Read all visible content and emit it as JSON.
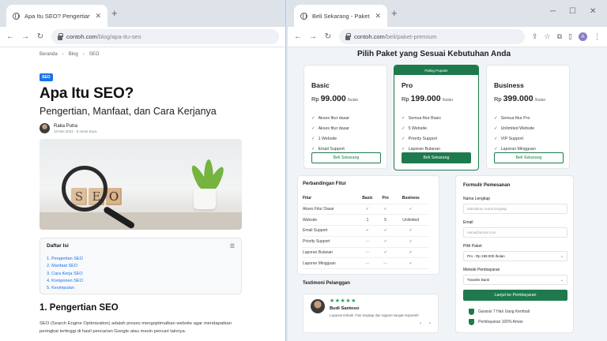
{
  "left_window": {
    "tab_title": "Apa Itu SEO? Pengertian, Manfaat, dan C",
    "url_host": "contoh.com",
    "url_path": "/blog/apa-itu-seo",
    "breadcrumb": [
      "Beranda",
      "Blog",
      "SEO"
    ],
    "badge": "SEO",
    "title": "Apa Itu SEO?",
    "subtitle": "Pengertian, Manfaat, dan Cara Kerjanya",
    "author_name": "Raka Putra",
    "author_meta": "10 Mei 2024  ·  8 menit baca",
    "hero_letters": [
      "S",
      "E",
      "O"
    ],
    "toc_title": "Daftar Isi",
    "toc_items": [
      "1. Pengertian SEO",
      "2. Manfaat SEO",
      "3. Cara Kerja SEO",
      "4. Komponen SEO",
      "5. Kesimpulan"
    ],
    "section_heading": "1. Pengertian SEO",
    "paragraph": "SEO (Search Engine Optimization) adalah proses mengoptimalkan website agar mendapatkan peringkat tertinggi di hasil pencarian Google atau mesin pencari lainnya."
  },
  "right_window": {
    "tab_title": "Beli Sekarang - Paket Premium",
    "url_host": "contoh.com",
    "url_path": "/beli/paket-premium",
    "page_title": "Pilih Paket yang Sesuai Kebutuhan Anda",
    "popular_label": "Paling Populer",
    "plans": [
      {
        "name": "Basic",
        "currency": "Rp",
        "price": "99.000",
        "period": "/bulan",
        "features": [
          "Akses fitur dasar",
          "Akses fitur dasar",
          "1 Website",
          "Email Support"
        ],
        "button": "Beli Sekarang"
      },
      {
        "name": "Pro",
        "currency": "Rp",
        "price": "199.000",
        "period": "/bulan",
        "features": [
          "Semua fitur Basic",
          "5 Website",
          "Priority Support",
          "Laporan Bulanan"
        ],
        "button": "Beli Sekarang"
      },
      {
        "name": "Business",
        "currency": "Rp",
        "price": "399.000",
        "period": "/bulan",
        "features": [
          "Semua fitur Pro",
          "Unlimited Website",
          "VIP Support",
          "Laporan Mingguan"
        ],
        "button": "Beli Sekarang"
      }
    ],
    "comparison": {
      "title": "Perbandingan Fitur",
      "headers": [
        "Fitur",
        "Basic",
        "Pro",
        "Business"
      ],
      "rows": [
        [
          "Akses Fitur Dasar",
          "✓",
          "✓",
          "✓"
        ],
        [
          "Website",
          "1",
          "5",
          "Unlimited"
        ],
        [
          "Email Support",
          "✓",
          "✓",
          "✓"
        ],
        [
          "Priority Support",
          "—",
          "✓",
          "✓"
        ],
        [
          "Laporan Bulanan",
          "—",
          "✓",
          "✓"
        ],
        [
          "Laporan Mingguan",
          "—",
          "—",
          "✓"
        ]
      ]
    },
    "testimonial": {
      "title": "Testimoni Pelanggan",
      "stars": "★★★★★",
      "name": "Budi Santoso",
      "text": "Layanan terbaik. Fitur lengkap dan support sangat responsif!"
    },
    "form": {
      "title": "Formulir Pemesanan",
      "name_label": "Nama Lengkap",
      "name_placeholder": "Masukkan nama lengkap",
      "email_label": "Email",
      "email_placeholder": "nama@email.com",
      "plan_label": "Pilih Paket",
      "plan_value": "Pro - Rp 199.000 /bulan",
      "method_label": "Metode Pembayaran",
      "method_value": "Transfer Bank",
      "submit": "Lanjut ke Pembayaran",
      "guarantees": [
        "Garansi 7 Hari Uang Kembali",
        "Pembayaran 100% Aman"
      ]
    },
    "avatar_letter": "A"
  }
}
